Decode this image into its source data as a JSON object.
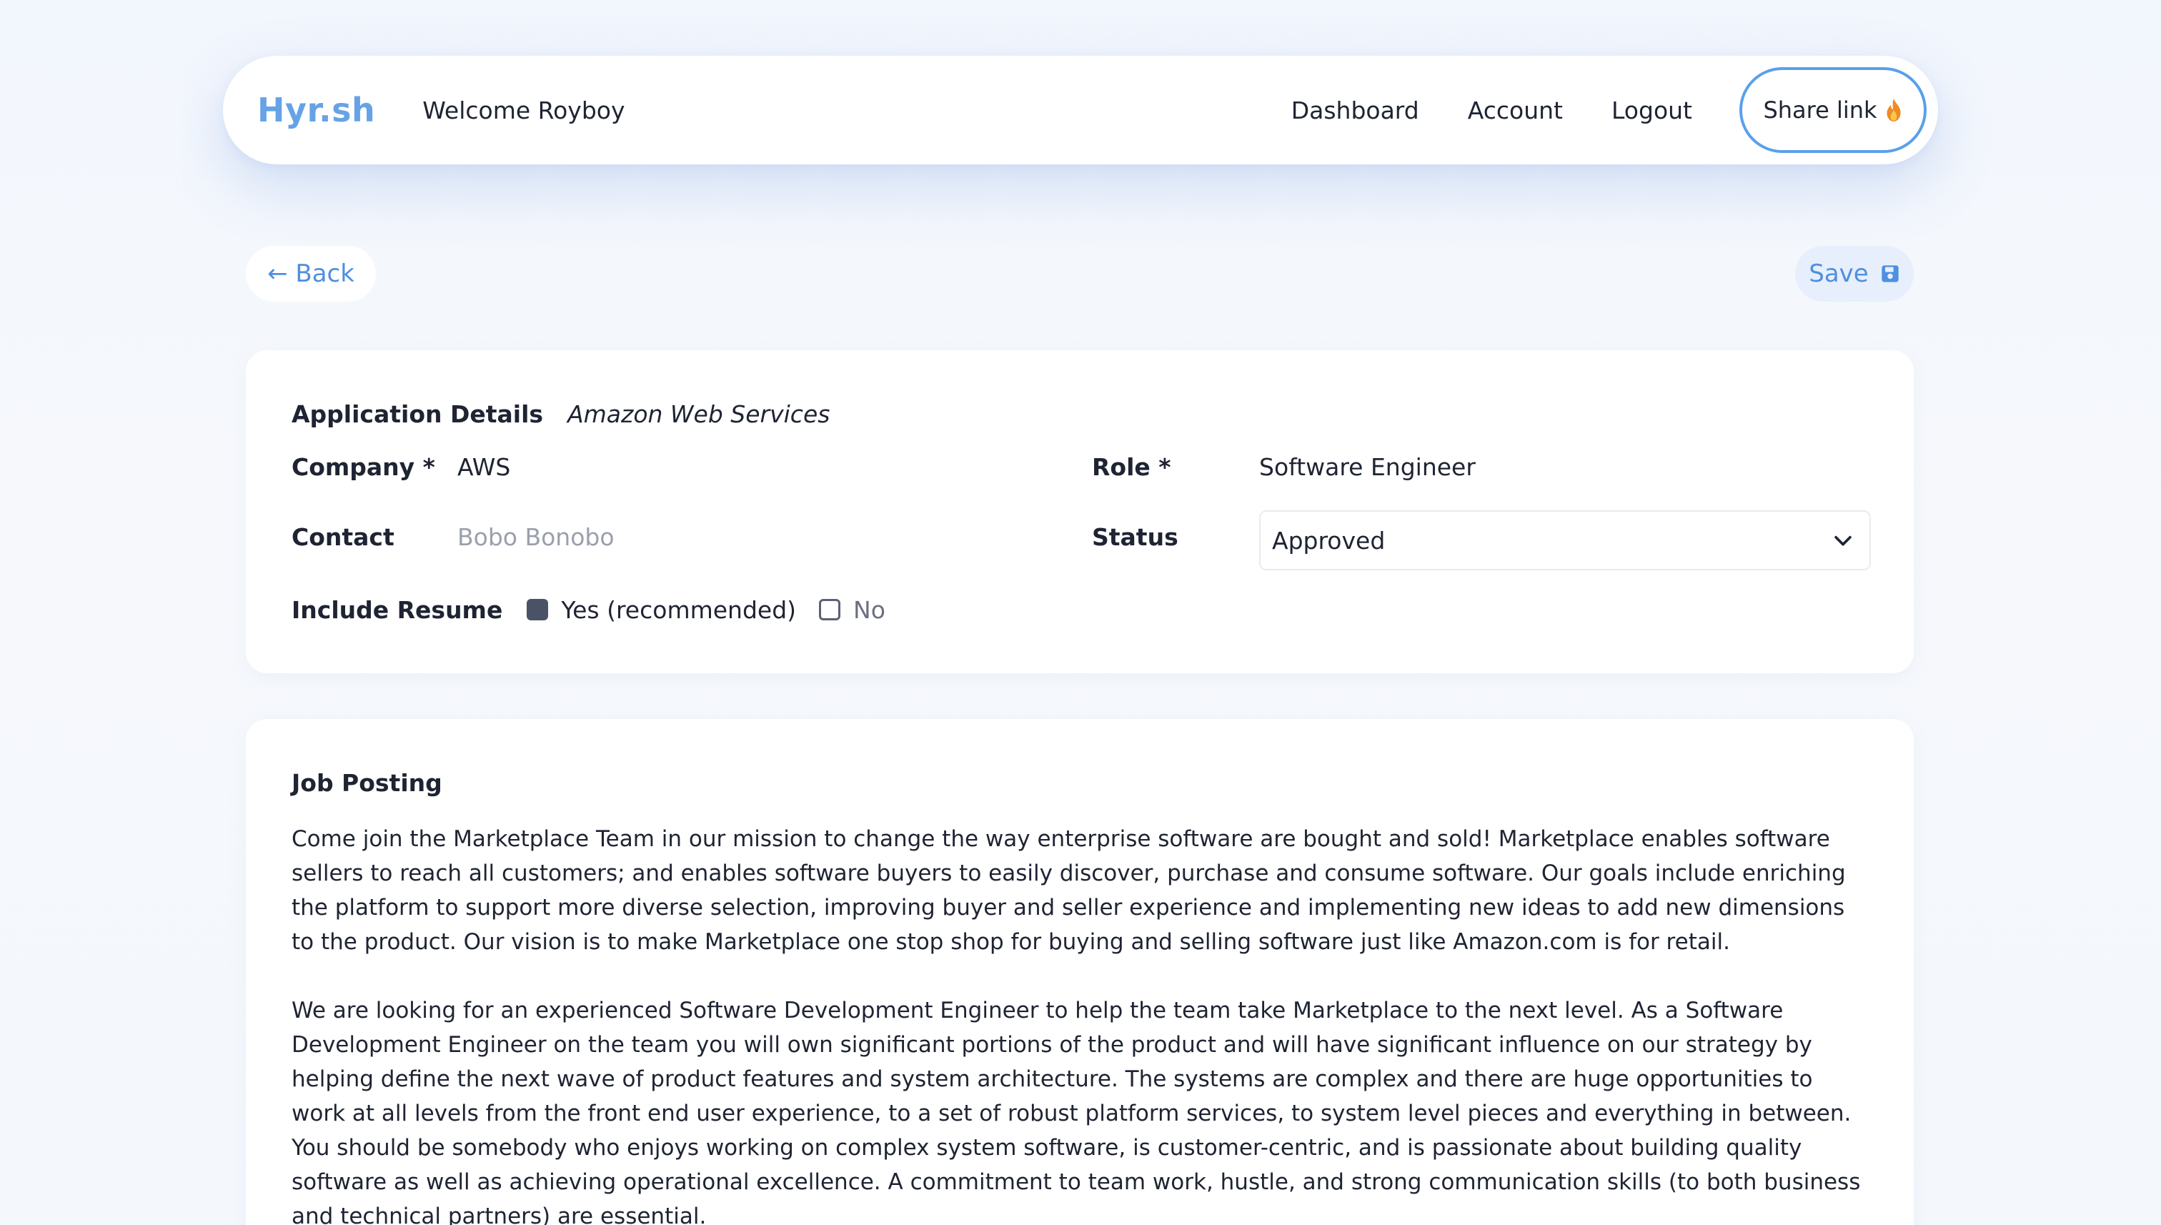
{
  "nav": {
    "brand": "Hyr.sh",
    "welcome": "Welcome Royboy",
    "links": [
      "Dashboard",
      "Account",
      "Logout"
    ],
    "share_label": "Share link",
    "share_icon": "flame-icon"
  },
  "actions": {
    "back_label": "← Back",
    "save_label": "Save",
    "save_icon": "floppy-disk-icon"
  },
  "details": {
    "title": "Application Details",
    "company_name": "Amazon Web Services",
    "company_label": "Company *",
    "company_value": "AWS",
    "role_label": "Role *",
    "role_value": "Software Engineer",
    "contact_label": "Contact",
    "contact_placeholder": "Bobo Bonobo",
    "status_label": "Status",
    "status_value": "Approved",
    "include_resume_label": "Include Resume",
    "resume_options": [
      {
        "label": "Yes (recommended)",
        "checked": true
      },
      {
        "label": "No",
        "checked": false
      }
    ]
  },
  "posting": {
    "title": "Job Posting",
    "paragraphs": [
      "Come join the Marketplace Team in our mission to change the way enterprise software are bought and sold! Marketplace enables software sellers to reach all customers; and enables software buyers to easily discover, purchase and consume software. Our goals include enriching the platform to support more diverse selection, improving buyer and seller experience and implementing new ideas to add new dimensions to the product. Our vision is to make Marketplace one stop shop for buying and selling software just like Amazon.com is for retail.",
      "We are looking for an experienced Software Development Engineer to help the team take Marketplace to the next level. As a Software Development Engineer on the team you will own significant portions of the product and will have significant influence on our strategy by helping define the next wave of product features and system architecture. The systems are complex and there are huge opportunities to work at all levels from the front end user experience, to a set of robust platform services, to system level pieces and everything in between. You should be somebody who enjoys working on complex system software, is customer-centric, and is passionate about building quality software as well as achieving operational excellence. A commitment to team work, hustle, and strong communication skills (to both business and technical partners) are essential."
    ]
  },
  "colors": {
    "brand": "#66a3e6",
    "accent": "#5aa0ea",
    "link": "#4f8fdf",
    "save_bg": "#e6effb"
  }
}
